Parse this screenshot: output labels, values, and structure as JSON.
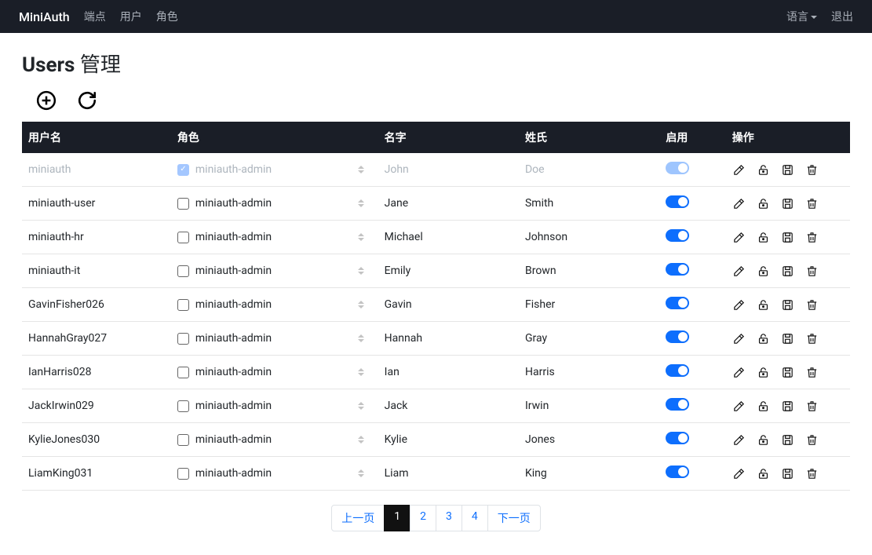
{
  "navbar": {
    "brand": "MiniAuth",
    "links": [
      "端点",
      "用户",
      "角色"
    ],
    "language_label": "语言",
    "logout_label": "退出"
  },
  "page": {
    "title_strong": "Users",
    "title_light": "管理"
  },
  "table": {
    "headers": {
      "username": "用户名",
      "role": "角色",
      "first": "名字",
      "last": "姓氏",
      "enable": "启用",
      "actions": "操作"
    },
    "role_option": "miniauth-admin",
    "rows": [
      {
        "username": "miniauth",
        "role_checked": true,
        "first": "John",
        "last": "Doe",
        "enabled": true,
        "row_disabled": true
      },
      {
        "username": "miniauth-user",
        "role_checked": false,
        "first": "Jane",
        "last": "Smith",
        "enabled": true,
        "row_disabled": false
      },
      {
        "username": "miniauth-hr",
        "role_checked": false,
        "first": "Michael",
        "last": "Johnson",
        "enabled": true,
        "row_disabled": false
      },
      {
        "username": "miniauth-it",
        "role_checked": false,
        "first": "Emily",
        "last": "Brown",
        "enabled": true,
        "row_disabled": false
      },
      {
        "username": "GavinFisher026",
        "role_checked": false,
        "first": "Gavin",
        "last": "Fisher",
        "enabled": true,
        "row_disabled": false
      },
      {
        "username": "HannahGray027",
        "role_checked": false,
        "first": "Hannah",
        "last": "Gray",
        "enabled": true,
        "row_disabled": false
      },
      {
        "username": "IanHarris028",
        "role_checked": false,
        "first": "Ian",
        "last": "Harris",
        "enabled": true,
        "row_disabled": false
      },
      {
        "username": "JackIrwin029",
        "role_checked": false,
        "first": "Jack",
        "last": "Irwin",
        "enabled": true,
        "row_disabled": false
      },
      {
        "username": "KylieJones030",
        "role_checked": false,
        "first": "Kylie",
        "last": "Jones",
        "enabled": true,
        "row_disabled": false
      },
      {
        "username": "LiamKing031",
        "role_checked": false,
        "first": "Liam",
        "last": "King",
        "enabled": true,
        "row_disabled": false
      }
    ]
  },
  "pagination": {
    "prev": "上一页",
    "next": "下一页",
    "pages": [
      "1",
      "2",
      "3",
      "4"
    ],
    "active": "1"
  }
}
